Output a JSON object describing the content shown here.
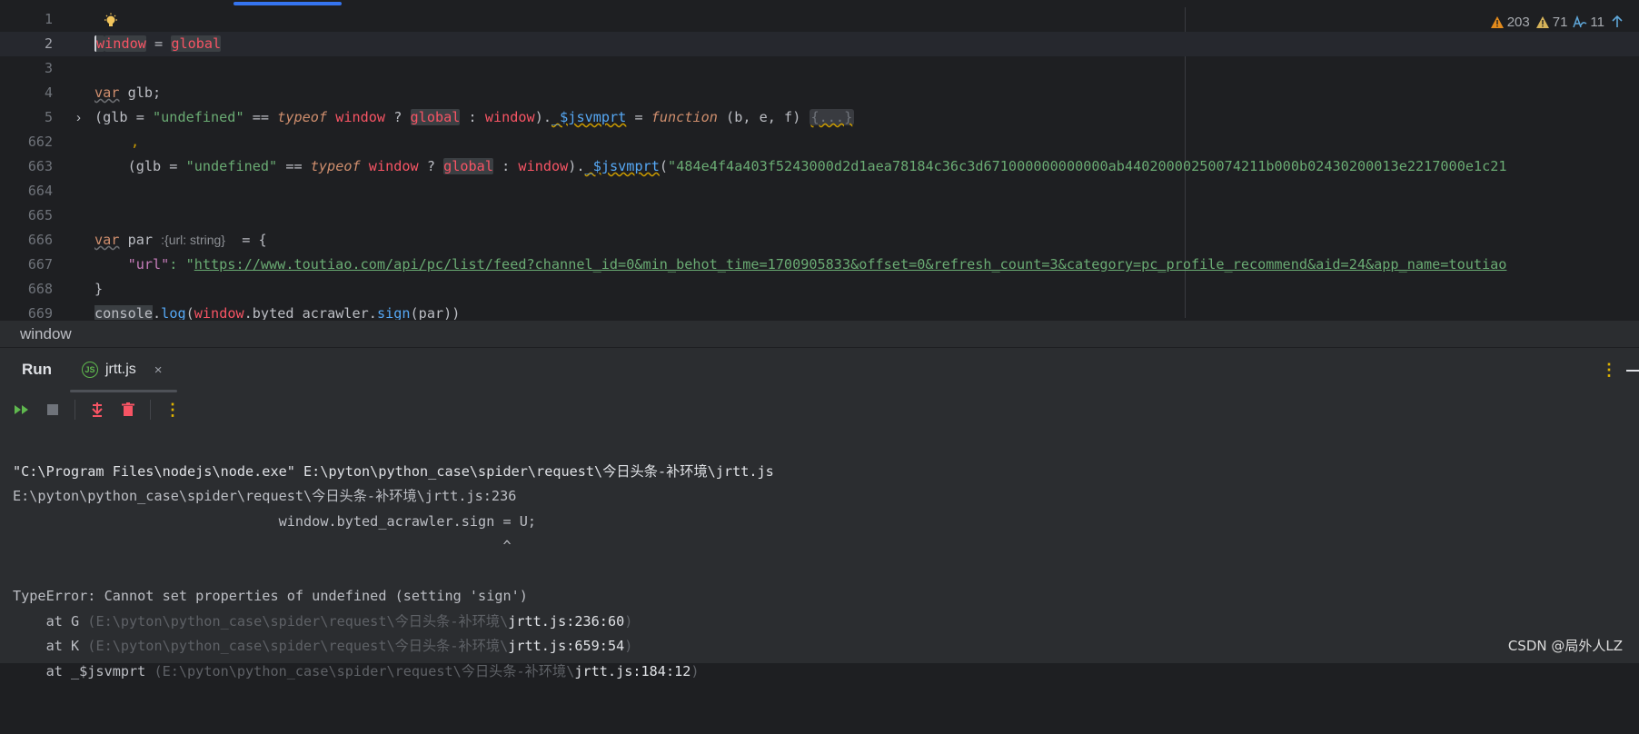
{
  "editor": {
    "line_numbers": [
      "1",
      "2",
      "3",
      "4",
      "5",
      "662",
      "663",
      "664",
      "665",
      "666",
      "667",
      "668",
      "669"
    ],
    "line2": {
      "w": "w",
      "rest": "indow",
      "eq": " = ",
      "global": "global"
    },
    "line4": {
      "var": "var",
      "rest": " glb;"
    },
    "line5": {
      "a": "(glb = ",
      "str": "\"undefined\"",
      "b": " == ",
      "typeof": "typeof",
      "c": " ",
      "window": "window",
      "d": " ? ",
      "global": "global",
      "e": " : ",
      "window2": "window",
      "f": ").",
      "fn": "_$jsvmprt",
      "g": " = ",
      "function": "function",
      "h": " (b, e, f) ",
      "fold": "{...}"
    },
    "line662": {
      "tick": ","
    },
    "line663": {
      "a": "    (glb = ",
      "str": "\"undefined\"",
      "b": " == ",
      "typeof": "typeof",
      "c": " ",
      "window": "window",
      "d": " ? ",
      "global": "global",
      "e": " : ",
      "window2": "window",
      "f": ").",
      "fn": "_$jsvmprt",
      "g": "(",
      "hex": "\"484e4f4a403f5243000d2d1aea78184c36c3d671000000000000ab44020000250074211b000b02430200013e2217000e1c21"
    },
    "line666": {
      "var": "var",
      "rest": " par ",
      "hint": ":{url: string}",
      "tail": "  = {"
    },
    "line667": {
      "a": "    ",
      "key": "\"url\"",
      "b": ": \"",
      "url": "https://www.toutiao.com/api/pc/list/feed?channel_id=0&min_behot_time=1700905833&offset=0&refresh_count=3&category=pc_profile_recommend&aid=24&app_name=toutiao"
    },
    "line668": {
      "text": "}"
    },
    "line669": {
      "console": "console",
      "dot": ".",
      "log": "log",
      "p": "(",
      "window": "window",
      "rest": ".byted_acrawler.",
      "sign": "sign",
      "end": "(par))"
    }
  },
  "inspections": {
    "errors": "203",
    "warnings": "71",
    "typos": "11"
  },
  "breadcrumb": "window",
  "run": {
    "title": "Run",
    "tab_label": "jrtt.js",
    "tab_icon_text": "JS",
    "tab_close": "×"
  },
  "console": {
    "line1": "\"C:\\Program Files\\nodejs\\node.exe\" E:\\pyton\\python_case\\spider\\request\\今日头条-补环境\\jrtt.js",
    "line2": "E:\\pyton\\python_case\\spider\\request\\今日头条-补环境\\jrtt.js:236",
    "line3": "                                window.byted_acrawler.sign = U;",
    "line4": "                                                           ^",
    "line5": "",
    "line6": "TypeError: Cannot set properties of undefined (setting 'sign')",
    "stack": [
      {
        "at": "    at G ",
        "path": "(E:\\pyton\\python_case\\spider\\request\\今日头条-补环境\\",
        "file": "jrtt.js:236:60",
        "close": ")"
      },
      {
        "at": "    at K ",
        "path": "(E:\\pyton\\python_case\\spider\\request\\今日头条-补环境\\",
        "file": "jrtt.js:659:54",
        "close": ")"
      },
      {
        "at": "    at _$jsvmprt ",
        "path": "(E:\\pyton\\python_case\\spider\\request\\今日头条-补环境\\",
        "file": "jrtt.js:184:12",
        "close": ")"
      }
    ]
  },
  "watermark": "CSDN @局外人LZ",
  "colors": {
    "accent": "#3574f0",
    "warning": "#e0a000",
    "error": "#f75464",
    "run_green": "#5fb84e"
  }
}
